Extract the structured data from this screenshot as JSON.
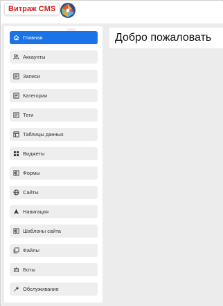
{
  "app": {
    "brand": "Витраж CMS",
    "logo_icon": "vitrazh-logo-icon"
  },
  "page": {
    "title": "Добро пожаловать"
  },
  "sidebar": {
    "items": [
      {
        "label": "Главная",
        "icon": "home-icon",
        "active": true
      },
      {
        "label": "Аккаунты",
        "icon": "users-icon",
        "active": false
      },
      {
        "label": "Записи",
        "icon": "document-icon",
        "active": false
      },
      {
        "label": "Категории",
        "icon": "document-icon",
        "active": false
      },
      {
        "label": "Теги",
        "icon": "document-icon",
        "active": false
      },
      {
        "label": "Таблицы данных",
        "icon": "table-icon",
        "active": false
      },
      {
        "label": "Виджеты",
        "icon": "widgets-icon",
        "active": false
      },
      {
        "label": "Формы",
        "icon": "forms-icon",
        "active": false
      },
      {
        "label": "Сайты",
        "icon": "globe-icon",
        "active": false
      },
      {
        "label": "Навигация",
        "icon": "navigation-arrow-icon",
        "active": false
      },
      {
        "label": "Шаблоны сайта",
        "icon": "forms-icon",
        "active": false
      },
      {
        "label": "Файлы",
        "icon": "files-icon",
        "active": false
      },
      {
        "label": "Боты",
        "icon": "bot-icon",
        "active": false
      },
      {
        "label": "Обслуживание",
        "icon": "wrench-icon",
        "active": false
      }
    ]
  },
  "colors": {
    "accent": "#1a73e8",
    "brand": "#d32222",
    "content_bg": "#ececec"
  }
}
